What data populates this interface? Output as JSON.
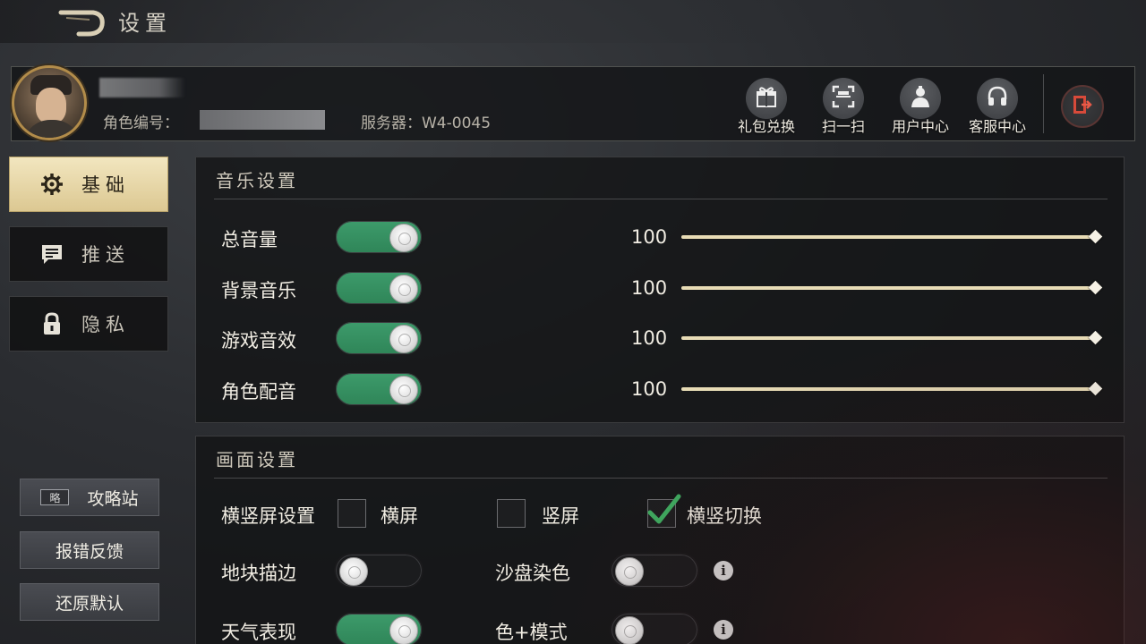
{
  "header": {
    "title": "设置"
  },
  "profile": {
    "role_id_label": "角色编号：",
    "server_label": "服务器：W4-0045",
    "buttons": [
      {
        "label": "礼包兑换",
        "icon": "gift-icon"
      },
      {
        "label": "扫一扫",
        "icon": "scan-icon"
      },
      {
        "label": "用户中心",
        "icon": "user-icon"
      },
      {
        "label": "客服中心",
        "icon": "headset-icon"
      }
    ],
    "exit_icon": "exit-icon"
  },
  "nav": {
    "items": [
      {
        "label": "基础",
        "icon": "gear-icon",
        "active": true
      },
      {
        "label": "推送",
        "icon": "message-icon",
        "active": false
      },
      {
        "label": "隐私",
        "icon": "lock-icon",
        "active": false
      }
    ]
  },
  "side_buttons": {
    "strategy_label": "攻略站",
    "strategy_icon_text": "略",
    "feedback_label": "报错反馈",
    "restore_label": "还原默认"
  },
  "music": {
    "title": "音乐设置",
    "rows": [
      {
        "label": "总音量",
        "enabled": true,
        "value": "100",
        "level": 1.0
      },
      {
        "label": "背景音乐",
        "enabled": true,
        "value": "100",
        "level": 1.0
      },
      {
        "label": "游戏音效",
        "enabled": true,
        "value": "100",
        "level": 1.0
      },
      {
        "label": "角色配音",
        "enabled": true,
        "value": "100",
        "level": 1.0
      }
    ]
  },
  "display": {
    "title": "画面设置",
    "orientation": {
      "label": "横竖屏设置",
      "options": [
        {
          "label": "横屏",
          "checked": false
        },
        {
          "label": "竖屏",
          "checked": false
        },
        {
          "label": "横竖切换",
          "checked": true
        }
      ]
    },
    "tile_outline": {
      "label": "地块描边",
      "enabled": false
    },
    "sandbox_color": {
      "label": "沙盘染色",
      "enabled": false
    },
    "weather": {
      "label": "天气表现",
      "enabled": true
    },
    "color_mode": {
      "label": "色+模式",
      "enabled": false
    }
  },
  "colors": {
    "accent_green": "#3d9b6b",
    "active_tab": "#e8dabb"
  }
}
